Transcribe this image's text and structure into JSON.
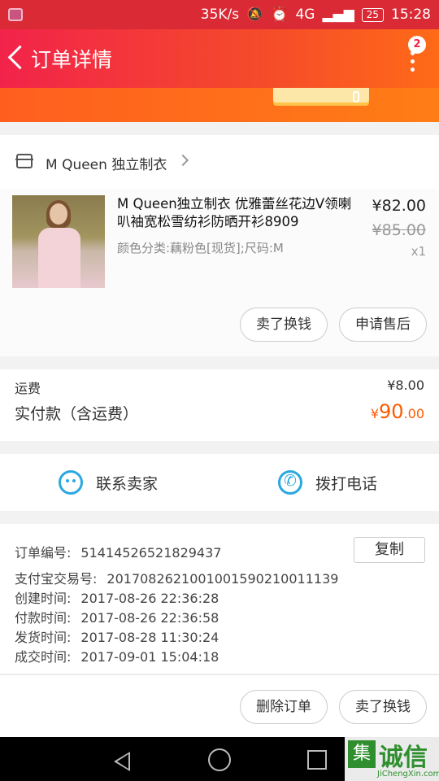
{
  "status_bar": {
    "network_speed": "35K/s",
    "signal_label": "4G",
    "battery": "25",
    "time": "15:28"
  },
  "header": {
    "title": "订单详情",
    "badge_count": "2"
  },
  "shop": {
    "name": "M Queen 独立制衣"
  },
  "product": {
    "name": "M Queen独立制衣 优雅蕾丝花边V领喇叭袖宽松雪纺衫防晒开衫8909",
    "spec": "颜色分类:藕粉色[现货];尺码:M",
    "price": "¥82.00",
    "original_price": "¥85.00",
    "quantity": "x1",
    "buttons": {
      "sell": "卖了换钱",
      "after_sale": "申请售后"
    }
  },
  "fees": {
    "shipping_label": "运费",
    "shipping_value": "¥8.00",
    "paid_label": "实付款（含运费）",
    "paid_currency": "¥",
    "paid_int": "90",
    "paid_dec": ".00"
  },
  "contact": {
    "seller": "联系卖家",
    "call": "拨打电话"
  },
  "order": {
    "number_label": "订单编号:",
    "number": "51414526521829437",
    "copy": "复制",
    "alipay_label": "支付宝交易号:",
    "alipay": "2017082621001001590210011139",
    "created_label": "创建时间:",
    "created": "2017-08-26 22:36:28",
    "paid_label": "付款时间:",
    "paid": "2017-08-26 22:36:58",
    "shipped_label": "发货时间:",
    "shipped": "2017-08-28 11:30:24",
    "done_label": "成交时间:",
    "done": "2017-09-01 15:04:18"
  },
  "bottom": {
    "delete": "删除订单",
    "sell": "卖了换钱"
  },
  "watermark": {
    "text": "诚信",
    "box": "集",
    "url": "JiChengXin.com"
  },
  "colors": {
    "accent": "#ff5a00",
    "header": "#f2234a",
    "icon": "#2aa8e0"
  }
}
